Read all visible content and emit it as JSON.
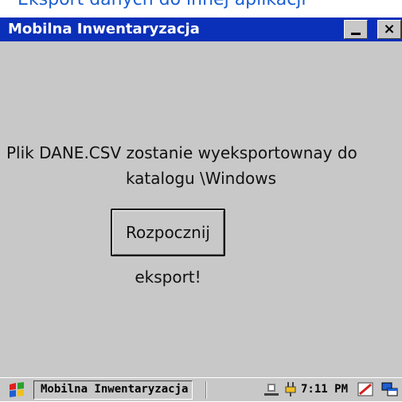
{
  "caption": {
    "text": "Eksport danych do innej aplikacji"
  },
  "window": {
    "title": "Mobilna Inwentaryzacja",
    "minimize_label": "_",
    "close_label": "×"
  },
  "content": {
    "message_line1": "Plik DANE.CSV zostanie wyeksportownay do",
    "message_line2": "katalogu \\Windows",
    "export_button_label": "Rozpocznij eksport!"
  },
  "taskbar": {
    "task_label": "Mobilna Inwentaryzacja",
    "clock": "7:11 PM",
    "icons": [
      "start-icon",
      "network-icon",
      "power-icon",
      "pen-icon",
      "windows-icon"
    ]
  },
  "colors": {
    "titlebar": "#0a2fb8",
    "client": "#c8c8c8",
    "caption_text": "#1a5fd0"
  }
}
